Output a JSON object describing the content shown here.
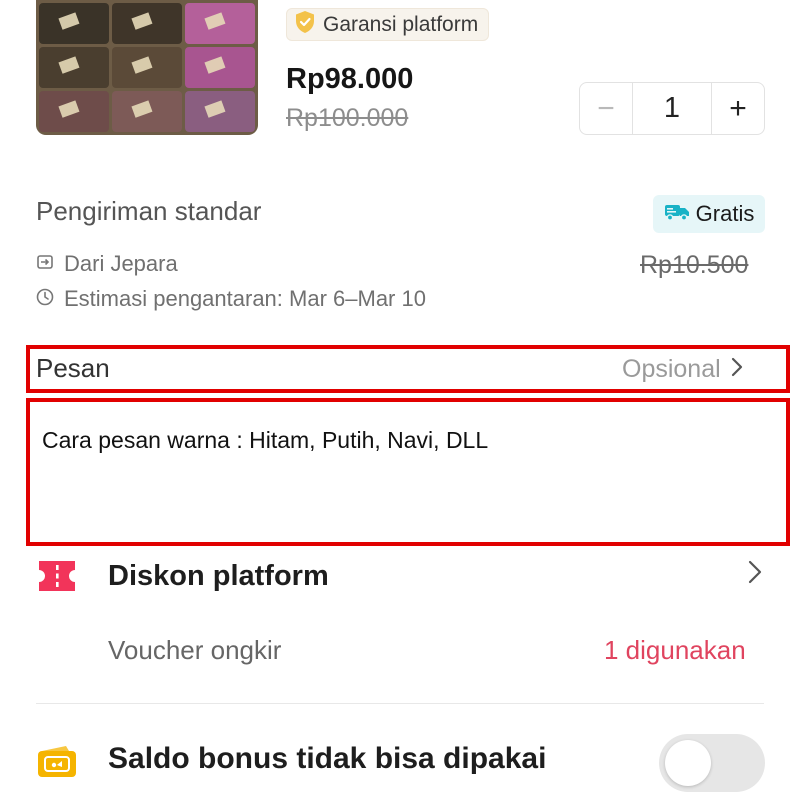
{
  "product": {
    "badge_label": "Garansi platform",
    "price": "Rp98.000",
    "original_price": "Rp100.000",
    "quantity": "1",
    "minus_symbol": "−",
    "plus_symbol": "+",
    "image_colors": [
      "#3a3328",
      "#3f3529",
      "#b4609a",
      "#4a3e2f",
      "#5b4a38",
      "#a85590",
      "#6e4c4a",
      "#7d5a57",
      "#8a5e80"
    ]
  },
  "shipping": {
    "title": "Pengiriman standar",
    "badge_label": "Gratis",
    "from": "Dari Jepara",
    "estimate": "Estimasi pengantaran: Mar 6–Mar 10",
    "original_cost": "Rp10.500"
  },
  "message": {
    "label": "Pesan",
    "optional_label": "Opsional",
    "text": "Cara pesan warna : Hitam, Putih, Navi, DLL"
  },
  "discount": {
    "title": "Diskon platform",
    "voucher_label": "Voucher ongkir",
    "voucher_value": "1 digunakan"
  },
  "bonus": {
    "title": "Saldo bonus tidak bisa dipakai",
    "toggle_on": false
  },
  "colors": {
    "accent_red": "#e0445f",
    "highlight_red": "#e10000",
    "gratis_bg": "#e6f6f8",
    "gratis_icon": "#19b2c6"
  }
}
